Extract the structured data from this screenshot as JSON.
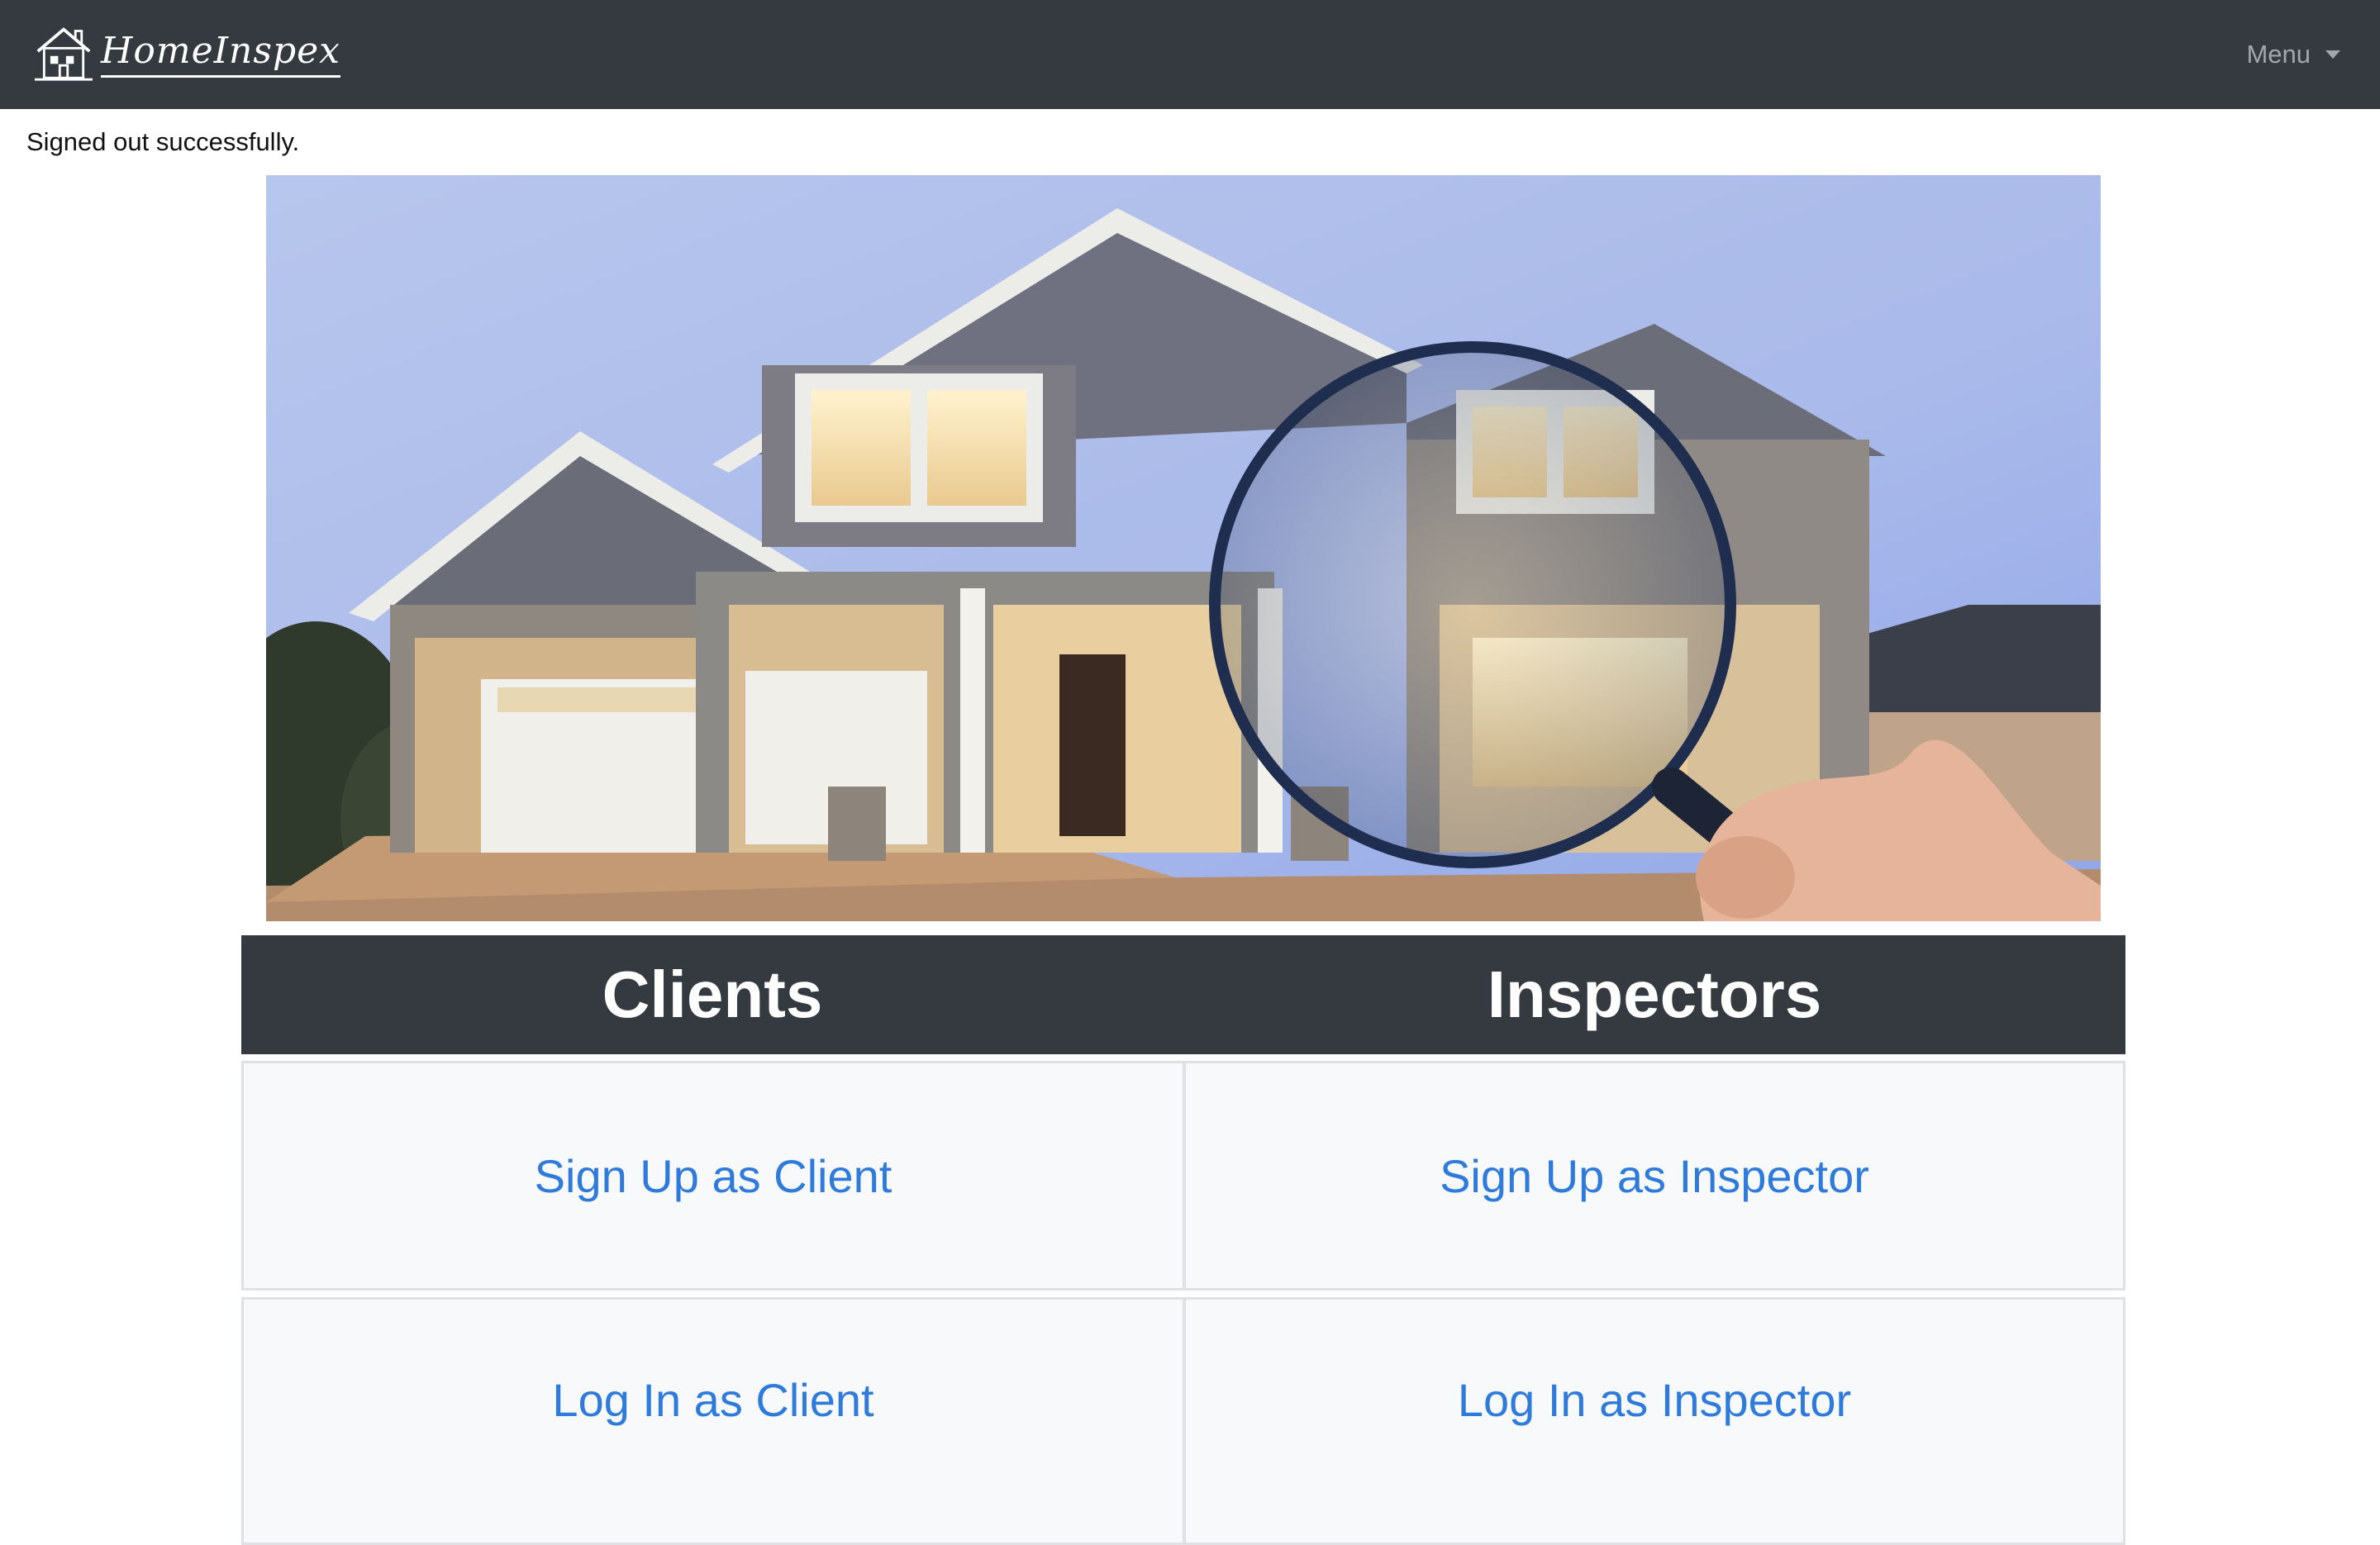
{
  "navbar": {
    "brand_text": "HomeInspex",
    "menu_label": "Menu"
  },
  "flash": {
    "notice": "Signed out successfully."
  },
  "hero": {
    "image": "house-with-magnifying-glass"
  },
  "columns": {
    "clients": {
      "title": "Clients",
      "sign_up": "Sign Up as Client",
      "log_in": "Log In as Client"
    },
    "inspectors": {
      "title": "Inspectors",
      "sign_up": "Sign Up as Inspector",
      "log_in": "Log In as Inspector"
    }
  },
  "colors": {
    "navbar_bg": "#343a40",
    "link": "#2f7bdc",
    "card_bg": "#f8f9fa",
    "card_border": "#dfe1e4"
  }
}
